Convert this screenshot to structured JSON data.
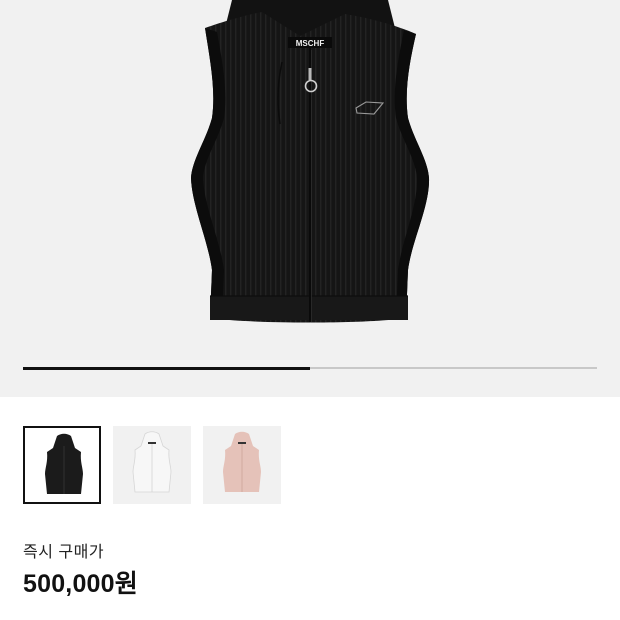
{
  "product": {
    "image_alt": "MSCHF hooded zip-up knit vest",
    "brand_label": "MSCHF",
    "gallery_progress": 0.5
  },
  "thumbnails": [
    {
      "color_name": "black",
      "fill": "#1b1b1b",
      "selected": true
    },
    {
      "color_name": "white",
      "fill": "#f7f7f7",
      "selected": false
    },
    {
      "color_name": "pink",
      "fill": "#e5c2b9",
      "selected": false
    }
  ],
  "purchase": {
    "buy_now_label": "즉시 구매가",
    "price": "500,000원"
  }
}
